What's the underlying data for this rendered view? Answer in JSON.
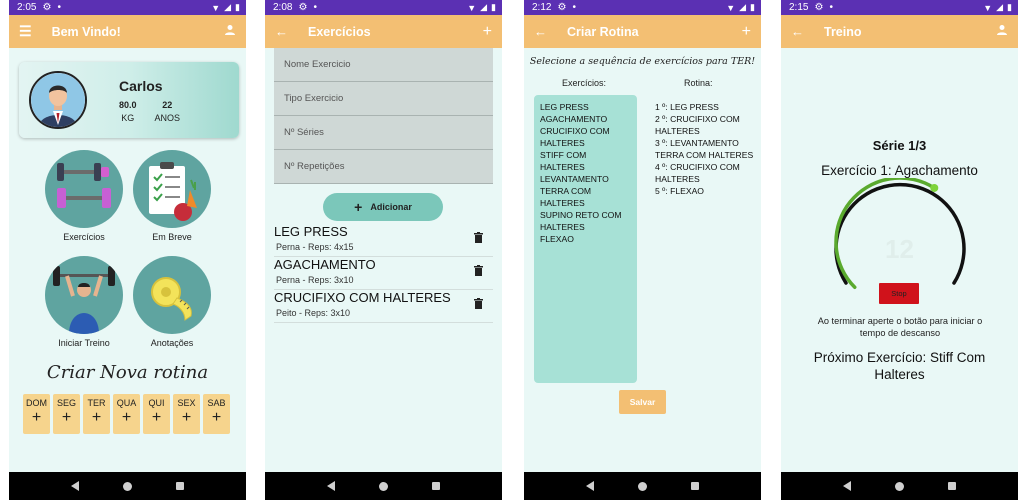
{
  "screens": {
    "home": {
      "status": {
        "time": "2:05"
      },
      "title": "Bem Vindo!",
      "profile": {
        "name": "Carlos",
        "weight": "80.0",
        "weight_unit": "KG",
        "age": "22",
        "age_unit": "ANOS"
      },
      "menu": {
        "exercicios": "Exercícios",
        "em_breve": "Em Breve",
        "iniciar_treino": "Iniciar Treino",
        "anotacoes": "Anotações"
      },
      "create_routine_title": "Criar Nova rotina",
      "days": [
        "DOM",
        "SEG",
        "TER",
        "QUA",
        "QUI",
        "SEX",
        "SAB"
      ],
      "plus": "+"
    },
    "exercicios": {
      "status": {
        "time": "2:08"
      },
      "title": "Exercícios",
      "fields": {
        "nome": "Nome Exercicio",
        "tipo": "Tipo Exercicio",
        "series": "Nº Séries",
        "repeticoes": "Nº Repetições"
      },
      "add_button": "Adicionar",
      "items": [
        {
          "name": "LEG PRESS",
          "detail": "Perna - Reps: 4x15"
        },
        {
          "name": "AGACHAMENTO",
          "detail": "Perna - Reps: 3x10"
        },
        {
          "name": "CRUCIFIXO COM HALTERES",
          "detail": "Peito - Reps: 3x10"
        }
      ]
    },
    "rotina": {
      "status": {
        "time": "2:12"
      },
      "title": "Criar Rotina",
      "subtitle": "Selecione a sequência de exercícios para TER!",
      "col_exercicios": "Exercícios:",
      "col_rotina": "Rotina:",
      "exercicios": [
        "LEG PRESS",
        "AGACHAMENTO",
        "CRUCIFIXO COM HALTERES",
        "STIFF COM HALTERES",
        "LEVANTAMENTO TERRA COM HALTERES",
        "SUPINO RETO COM HALTERES",
        "FLEXAO"
      ],
      "rotina": [
        "1 º: LEG PRESS",
        "2 º: CRUCIFIXO COM HALTERES",
        "3 º: LEVANTAMENTO TERRA COM HALTERES",
        "4 º: CRUCIFIXO COM HALTERES",
        "5 º: FLEXAO"
      ],
      "save_button": "Salvar"
    },
    "treino": {
      "status": {
        "time": "2:15"
      },
      "title": "Treino",
      "serie": "Série 1/3",
      "exercicio": "Exercício 1: Agachamento",
      "counter": "12",
      "progress_fraction": 0.62,
      "stop_button": "Stop",
      "hint": "Ao terminar aperte o botão para iniciar o tempo de descanso",
      "next": "Próximo Exercício: Stiff Com Halteres"
    }
  },
  "colors": {
    "status_bar": "#5b30b3",
    "app_bar": "#f3bf73",
    "background": "#e9f8f6",
    "accent_teal": "#7bc7ba",
    "gauge_green": "#5aaa2e",
    "stop_red": "#d0121b"
  }
}
